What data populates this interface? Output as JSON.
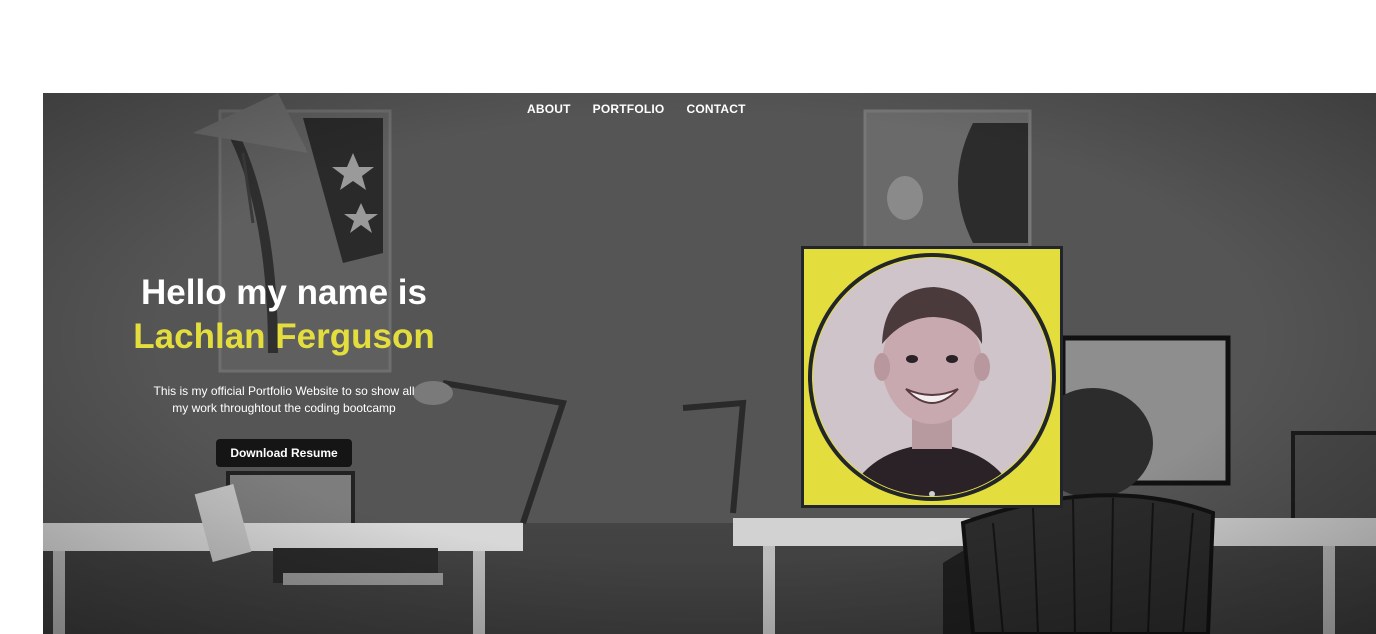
{
  "nav": {
    "items": [
      {
        "label": "ABOUT"
      },
      {
        "label": "PORTFOLIO"
      },
      {
        "label": "CONTACT"
      }
    ]
  },
  "hero": {
    "greeting": "Hello my name is",
    "name": "Lachlan Ferguson",
    "description": "This is my official Portfolio Website to so show all my work throughtout the coding bootcamp",
    "cta_label": "Download Resume"
  },
  "colors": {
    "accent": "#e3de3e",
    "button_bg": "#151515",
    "frame_border": "#22252a"
  }
}
